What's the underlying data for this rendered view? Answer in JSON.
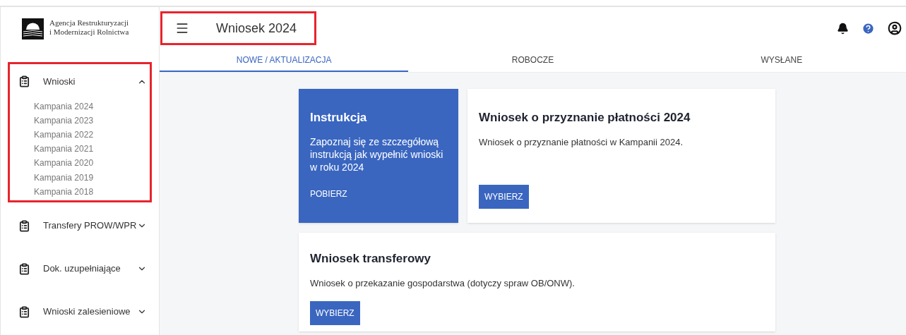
{
  "logo": {
    "name_lines": [
      "Agencja Restrukturyzacji",
      "i Modernizacji Rolnictwa"
    ]
  },
  "header": {
    "title": "Wniosek 2024",
    "highlighted": true
  },
  "tabs": [
    {
      "label": "NOWE / AKTUALIZACJA",
      "selected": true
    },
    {
      "label": "ROBOCZE",
      "selected": false
    },
    {
      "label": "WYSŁANE",
      "selected": false
    }
  ],
  "sidebar": {
    "groups": [
      {
        "label": "Wnioski",
        "expanded": true,
        "highlighted": true,
        "children": [
          {
            "label": "Kampania 2024"
          },
          {
            "label": "Kampania 2023"
          },
          {
            "label": "Kampania 2022"
          },
          {
            "label": "Kampania 2021"
          },
          {
            "label": "Kampania 2020"
          },
          {
            "label": "Kampania 2019"
          },
          {
            "label": "Kampania 2018"
          }
        ]
      },
      {
        "label": "Transfery PROW/WPR",
        "expanded": false,
        "highlighted": false
      },
      {
        "label": "Dok. uzupełniające",
        "expanded": false,
        "highlighted": false
      },
      {
        "label": "Wnioski zalesieniowe",
        "expanded": false,
        "highlighted": false
      }
    ]
  },
  "cards": [
    {
      "kind": "info",
      "title": "Instrukcja",
      "text": "Zapoznaj się ze szczegółową instrukcją jak wypełnić wnioski w roku 2024",
      "action": "POBIERZ"
    },
    {
      "kind": "form",
      "title": "Wniosek o przyznanie płatności 2024",
      "text": "Wniosek o przyznanie płatności w Kampanii 2024.",
      "action": "WYBIERZ"
    },
    {
      "kind": "form",
      "title": "Wniosek transferowy",
      "text": "Wniosek o przekazanie gospodarstwa (dotyczy spraw OB/ONW).",
      "action": "WYBIERZ"
    }
  ]
}
